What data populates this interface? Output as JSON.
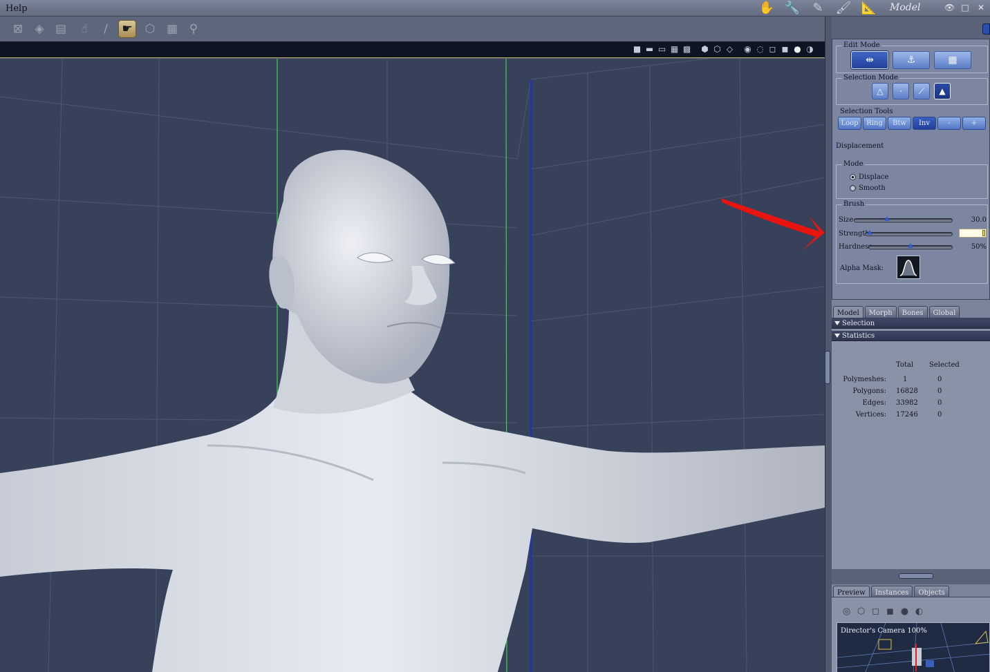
{
  "menubar": {
    "help": "Help"
  },
  "rooms": {
    "title": "Model",
    "icons": [
      "hand-icon",
      "wrench-icon",
      "pencil-icon",
      "brush-icon",
      "ruler-icon"
    ]
  },
  "window_controls": [
    "eye-icon",
    "maximize-icon",
    "close-icon"
  ],
  "toolbar": {
    "tools": [
      "select-icon",
      "cube-icon",
      "clipboard-icon",
      "hand-tool-icon",
      "pen-icon",
      "pose-icon",
      "morph-icon",
      "grid-icon",
      "dial-icon"
    ],
    "active_tool": "pose-icon"
  },
  "viewport": {
    "layout_icons": [
      "layout-single-icon",
      "layout-two-icon",
      "layout-three-icon",
      "layout-four-icon",
      "layout-grid-icon"
    ],
    "display_icons": [
      "bounding-box-icon",
      "lit-wire-icon",
      "hidden-line-icon",
      "cartoon-icon",
      "wireframe-icon",
      "flat-icon",
      "smooth-icon",
      "texture-icon"
    ]
  },
  "edit_mode": {
    "label": "Edit Mode",
    "buttons": [
      "move-select-icon",
      "ghost-select-icon",
      "wrap-icon"
    ],
    "active": 0
  },
  "selection_mode": {
    "label": "Selection Mode",
    "buttons": [
      "polygon-icon",
      "vertex-icon",
      "edge-icon",
      "face-icon"
    ],
    "active": 3
  },
  "selection_tools": {
    "label": "Selection Tools",
    "buttons": [
      "Loop",
      "Ring",
      "Btw",
      "Inv",
      "-",
      "+"
    ],
    "active": 3
  },
  "displacement": {
    "label": "Displacement"
  },
  "mode": {
    "label": "Mode",
    "options": [
      "Displace",
      "Smooth"
    ],
    "selected": 0
  },
  "brush": {
    "label": "Brush",
    "size": {
      "label": "Size",
      "value": "30.0",
      "level": 0.33
    },
    "strength": {
      "label": "Strength",
      "level": 0.05
    },
    "hardness": {
      "label": "Hardness",
      "value": "50%",
      "level": 0.5
    },
    "alpha_label": "Alpha Mask:"
  },
  "tabs": {
    "items": [
      "Model",
      "Morph",
      "Bones",
      "Global"
    ],
    "active": 0
  },
  "sections": {
    "selection": "Selection",
    "statistics": "Statistics"
  },
  "statistics": {
    "headers": {
      "total": "Total",
      "selected": "Selected"
    },
    "rows": [
      {
        "label": "Polymeshes:",
        "total": "1",
        "selected": "0"
      },
      {
        "label": "Polygons:",
        "total": "16828",
        "selected": "0"
      },
      {
        "label": "Edges:",
        "total": "33982",
        "selected": "0"
      },
      {
        "label": "Vertices:",
        "total": "17246",
        "selected": "0"
      }
    ]
  },
  "preview_tabs": {
    "items": [
      "Preview",
      "Instances",
      "Objects"
    ],
    "active": 0
  },
  "preview": {
    "camera_label": "Director's Camera 100%"
  },
  "colors": {
    "viewport_bg": "#37425a",
    "panel_bg": "#7c86a0",
    "accent_blue": "#2f5cc9",
    "annotation_red": "#e8140f"
  }
}
